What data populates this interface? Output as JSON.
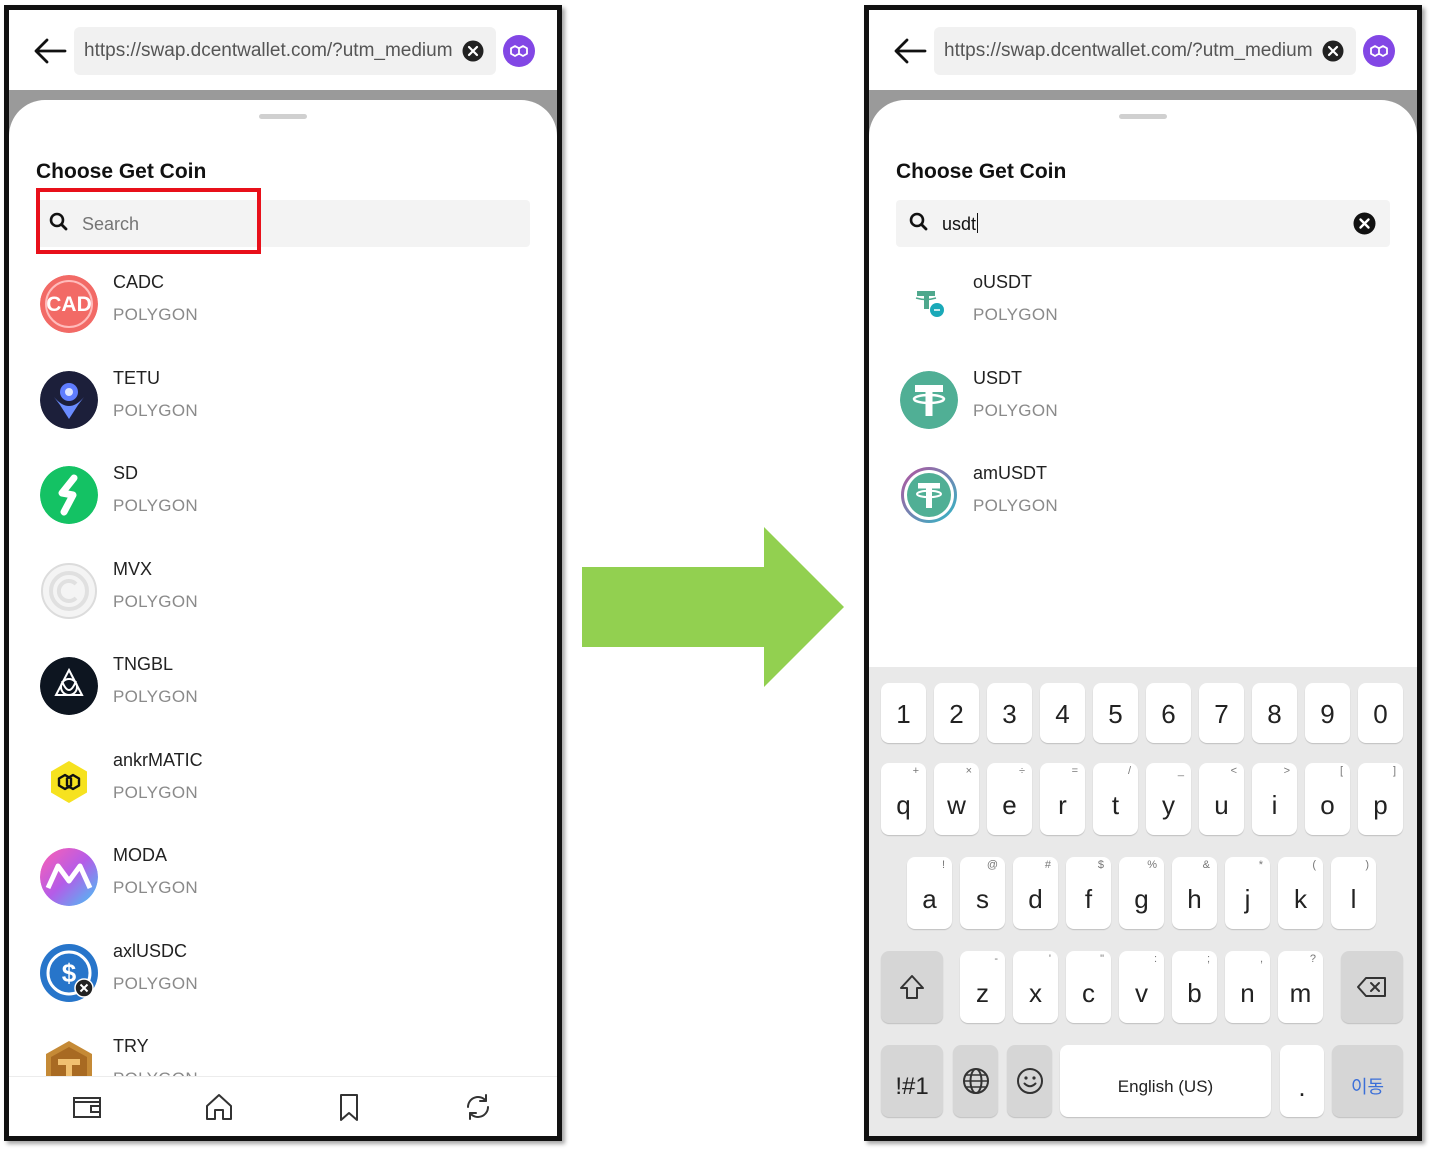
{
  "left_screen": {
    "url": "https://swap.dcentwallet.com/?utm_medium",
    "sheet_title": "Choose Get Coin",
    "search_placeholder": "Search",
    "coins": [
      {
        "symbol": "CADC",
        "network": "POLYGON",
        "logo_text": "CAD"
      },
      {
        "symbol": "TETU",
        "network": "POLYGON"
      },
      {
        "symbol": "SD",
        "network": "POLYGON"
      },
      {
        "symbol": "MVX",
        "network": "POLYGON"
      },
      {
        "symbol": "TNGBL",
        "network": "POLYGON"
      },
      {
        "symbol": "ankrMATIC",
        "network": "POLYGON"
      },
      {
        "symbol": "MODA",
        "network": "POLYGON"
      },
      {
        "symbol": "axlUSDC",
        "network": "POLYGON"
      },
      {
        "symbol": "TRY",
        "network": "POLYGON"
      }
    ],
    "bottom_nav": [
      "wallet-icon",
      "home-icon",
      "bookmark-icon",
      "refresh-icon"
    ]
  },
  "right_screen": {
    "url": "https://swap.dcentwallet.com/?utm_medium",
    "sheet_title": "Choose Get Coin",
    "search_value": "usdt",
    "coins": [
      {
        "symbol": "oUSDT",
        "network": "POLYGON"
      },
      {
        "symbol": "USDT",
        "network": "POLYGON"
      },
      {
        "symbol": "amUSDT",
        "network": "POLYGON"
      }
    ],
    "keyboard": {
      "numbers": [
        "1",
        "2",
        "3",
        "4",
        "5",
        "6",
        "7",
        "8",
        "9",
        "0"
      ],
      "row1": [
        [
          "q",
          "+"
        ],
        [
          "w",
          "×"
        ],
        [
          "e",
          "÷"
        ],
        [
          "r",
          "="
        ],
        [
          "t",
          "/"
        ],
        [
          "y",
          "_"
        ],
        [
          "u",
          "<"
        ],
        [
          "i",
          ">"
        ],
        [
          "o",
          "["
        ],
        [
          "p",
          "]"
        ]
      ],
      "row2": [
        [
          "a",
          "!"
        ],
        [
          "s",
          "@"
        ],
        [
          "d",
          "#"
        ],
        [
          "f",
          "$"
        ],
        [
          "g",
          "%"
        ],
        [
          "h",
          "&"
        ],
        [
          "j",
          "*"
        ],
        [
          "k",
          "("
        ],
        [
          "l",
          ")"
        ]
      ],
      "row3": [
        [
          "z",
          "-"
        ],
        [
          "x",
          "'"
        ],
        [
          "c",
          "\""
        ],
        [
          "v",
          ":"
        ],
        [
          "b",
          ";"
        ],
        [
          "n",
          ","
        ],
        [
          "m",
          "?"
        ]
      ],
      "symbols_label": "!#1",
      "space_label": "English (US)",
      "period_label": ".",
      "action_label": "이동"
    }
  },
  "colors": {
    "highlight": "#e8101a",
    "arrow": "#92d050",
    "polygon": "#8247e5"
  }
}
